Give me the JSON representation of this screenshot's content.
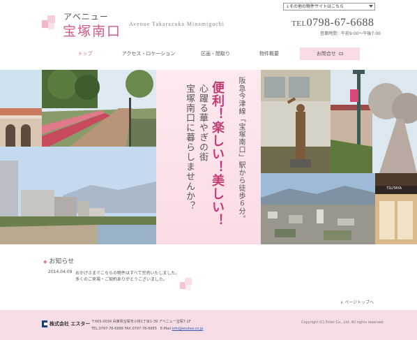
{
  "header": {
    "logo_kana": "アベニュー",
    "logo_name": "宝塚南口",
    "logo_en": "Avenue Takarazuka Minamiguchi",
    "site_select_value": "↓その他の物件サイトはこちら",
    "tel_prefix": "TEL",
    "tel_number": "0798-67-6688",
    "hours": "営業時間：午前9:00〜午後7:00"
  },
  "nav": {
    "items": [
      {
        "label": "トップ"
      },
      {
        "label": "アクセス・ロケーション"
      },
      {
        "label": "区画・間取り"
      },
      {
        "label": "物件概要"
      },
      {
        "label": "お問合せ"
      }
    ]
  },
  "hero": {
    "line1": "阪急今津線「宝塚南口」駅から徒歩６分。",
    "line2": "便利！楽しい！美しい！",
    "line3": "心躍る華やぎの街",
    "line4": "宝塚南口に暮らしませんか？",
    "shop_sign": "TSUTAYA"
  },
  "news": {
    "title": "お知らせ",
    "title_mark": "◆",
    "items": [
      {
        "date": "2014.04.09",
        "text1": "おかげさまでこちらの物件はすべて完売いたしました。",
        "text2": "多くのご来場・ご契約ありがとうございました。"
      }
    ]
  },
  "pagetop": "∧ ページトップへ",
  "footer": {
    "company_name": "株式会社 エスター",
    "address": "〒665-0034 兵庫県宝塚市小林1丁目1-39 アベニュー宝塚7-1F",
    "tel_fax": "TEL.0797-78-6688 FAX.0797-78-6665　E-Mail.",
    "email": "info@esutaa.co.jp",
    "copyright": "Copyright (C) Ester Co., Ltd. All rights reserved."
  },
  "colors": {
    "brand_pink": "#d05a88",
    "footer_bg": "#f6dce5",
    "nav_contact_bg": "#f9dbe5"
  }
}
